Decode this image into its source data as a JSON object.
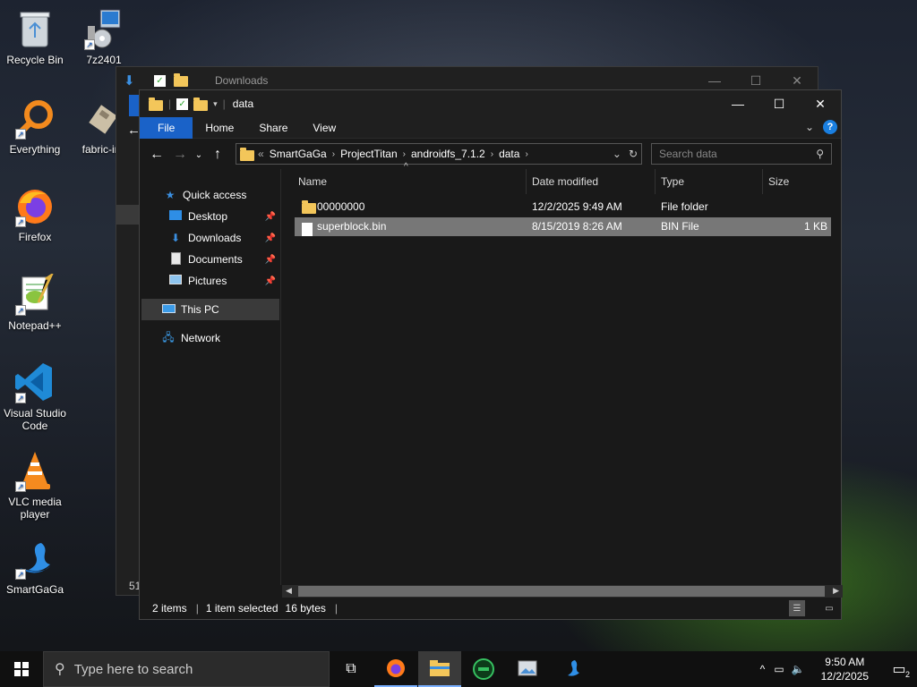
{
  "desktop": {
    "icons": [
      {
        "label": "Recycle Bin"
      },
      {
        "label": "7z2401"
      },
      {
        "label": "Everything"
      },
      {
        "label": "fabric-ins"
      },
      {
        "label": "Firefox"
      },
      {
        "label": "Notepad++"
      },
      {
        "label": "Visual Studio Code"
      },
      {
        "label": "VLC media player"
      },
      {
        "label": "SmartGaGa"
      }
    ]
  },
  "background_window": {
    "title": "Downloads",
    "left_peek_text": "51"
  },
  "window": {
    "title": "data",
    "ribbon_tabs": [
      "File",
      "Home",
      "Share",
      "View"
    ],
    "breadcrumb": [
      "SmartGaGa",
      "ProjectTitan",
      "androidfs_7.1.2",
      "data"
    ],
    "breadcrumb_overflow": "«",
    "search_placeholder": "Search data",
    "nav": {
      "quick_access": "Quick access",
      "desktop": "Desktop",
      "downloads": "Downloads",
      "documents": "Documents",
      "pictures": "Pictures",
      "this_pc": "This PC",
      "network": "Network"
    },
    "columns": {
      "name": "Name",
      "date": "Date modified",
      "type": "Type",
      "size": "Size"
    },
    "files": [
      {
        "name": "00000000",
        "date": "12/2/2025 9:49 AM",
        "type": "File folder",
        "size": ""
      },
      {
        "name": "superblock.bin",
        "date": "8/15/2019 8:26 AM",
        "type": "BIN File",
        "size": "1 KB"
      }
    ],
    "status": {
      "items": "2 items",
      "selected": "1 item selected",
      "bytes": "16 bytes"
    }
  },
  "taskbar": {
    "search_placeholder": "Type here to search",
    "time": "9:50 AM",
    "date": "12/2/2025",
    "notification_count": "2"
  },
  "colors": {
    "accent": "#1a62c8",
    "folder": "#f3c65a",
    "selection": "#777777"
  }
}
